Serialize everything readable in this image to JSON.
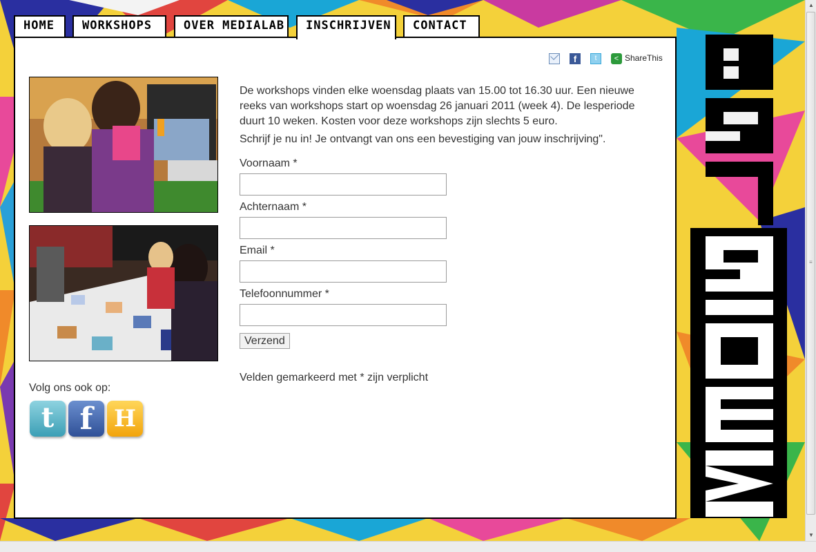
{
  "nav": {
    "tabs": [
      {
        "label": "HOME"
      },
      {
        "label": "WORKSHOPS"
      },
      {
        "label": "OVER MEDIALAB"
      },
      {
        "label": "INSCHRIJVEN",
        "active": true
      },
      {
        "label": "CONTACT"
      }
    ]
  },
  "share": {
    "label": "ShareThis"
  },
  "content": {
    "intro": "De workshops vinden elke woensdag plaats van 15.00 tot 16.30 uur. Een nieuwe reeks van workshops start op woensdag 26 januari 2011 (week 4). De lesperiode duurt 10 weken. Kosten voor deze workshops zijn slechts 5 euro.",
    "cta": "Schrijf je nu in! Je ontvangt van ons een bevestiging van jouw inschrijving\"."
  },
  "form": {
    "first_name_label": "Voornaam *",
    "last_name_label": "Achternaam *",
    "email_label": "Email *",
    "phone_label": "Telefoonnummer *",
    "first_name_value": "",
    "last_name_value": "",
    "email_value": "",
    "phone_value": "",
    "submit_label": "Verzend",
    "required_note": "Velden gemarkeerd met * zijn verplicht"
  },
  "social": {
    "follow_label": "Volg ons ook op:",
    "icons": [
      "twitter-icon",
      "facebook-icon",
      "hyves-icon"
    ]
  },
  "logo": {
    "text": "MEDIALAB"
  },
  "colors": {
    "accent": "#000000",
    "panel": "#ffffff"
  }
}
